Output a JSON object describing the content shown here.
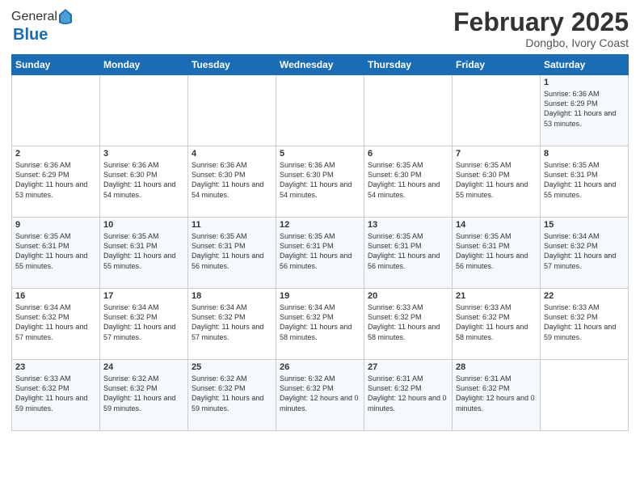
{
  "logo": {
    "general": "General",
    "blue": "Blue"
  },
  "title": "February 2025",
  "location": "Dongbo, Ivory Coast",
  "days_of_week": [
    "Sunday",
    "Monday",
    "Tuesday",
    "Wednesday",
    "Thursday",
    "Friday",
    "Saturday"
  ],
  "weeks": [
    [
      {
        "day": "",
        "info": ""
      },
      {
        "day": "",
        "info": ""
      },
      {
        "day": "",
        "info": ""
      },
      {
        "day": "",
        "info": ""
      },
      {
        "day": "",
        "info": ""
      },
      {
        "day": "",
        "info": ""
      },
      {
        "day": "1",
        "info": "Sunrise: 6:36 AM\nSunset: 6:29 PM\nDaylight: 11 hours and 53 minutes."
      }
    ],
    [
      {
        "day": "2",
        "info": "Sunrise: 6:36 AM\nSunset: 6:29 PM\nDaylight: 11 hours and 53 minutes."
      },
      {
        "day": "3",
        "info": "Sunrise: 6:36 AM\nSunset: 6:30 PM\nDaylight: 11 hours and 54 minutes."
      },
      {
        "day": "4",
        "info": "Sunrise: 6:36 AM\nSunset: 6:30 PM\nDaylight: 11 hours and 54 minutes."
      },
      {
        "day": "5",
        "info": "Sunrise: 6:36 AM\nSunset: 6:30 PM\nDaylight: 11 hours and 54 minutes."
      },
      {
        "day": "6",
        "info": "Sunrise: 6:35 AM\nSunset: 6:30 PM\nDaylight: 11 hours and 54 minutes."
      },
      {
        "day": "7",
        "info": "Sunrise: 6:35 AM\nSunset: 6:30 PM\nDaylight: 11 hours and 55 minutes."
      },
      {
        "day": "8",
        "info": "Sunrise: 6:35 AM\nSunset: 6:31 PM\nDaylight: 11 hours and 55 minutes."
      }
    ],
    [
      {
        "day": "9",
        "info": "Sunrise: 6:35 AM\nSunset: 6:31 PM\nDaylight: 11 hours and 55 minutes."
      },
      {
        "day": "10",
        "info": "Sunrise: 6:35 AM\nSunset: 6:31 PM\nDaylight: 11 hours and 55 minutes."
      },
      {
        "day": "11",
        "info": "Sunrise: 6:35 AM\nSunset: 6:31 PM\nDaylight: 11 hours and 56 minutes."
      },
      {
        "day": "12",
        "info": "Sunrise: 6:35 AM\nSunset: 6:31 PM\nDaylight: 11 hours and 56 minutes."
      },
      {
        "day": "13",
        "info": "Sunrise: 6:35 AM\nSunset: 6:31 PM\nDaylight: 11 hours and 56 minutes."
      },
      {
        "day": "14",
        "info": "Sunrise: 6:35 AM\nSunset: 6:31 PM\nDaylight: 11 hours and 56 minutes."
      },
      {
        "day": "15",
        "info": "Sunrise: 6:34 AM\nSunset: 6:32 PM\nDaylight: 11 hours and 57 minutes."
      }
    ],
    [
      {
        "day": "16",
        "info": "Sunrise: 6:34 AM\nSunset: 6:32 PM\nDaylight: 11 hours and 57 minutes."
      },
      {
        "day": "17",
        "info": "Sunrise: 6:34 AM\nSunset: 6:32 PM\nDaylight: 11 hours and 57 minutes."
      },
      {
        "day": "18",
        "info": "Sunrise: 6:34 AM\nSunset: 6:32 PM\nDaylight: 11 hours and 57 minutes."
      },
      {
        "day": "19",
        "info": "Sunrise: 6:34 AM\nSunset: 6:32 PM\nDaylight: 11 hours and 58 minutes."
      },
      {
        "day": "20",
        "info": "Sunrise: 6:33 AM\nSunset: 6:32 PM\nDaylight: 11 hours and 58 minutes."
      },
      {
        "day": "21",
        "info": "Sunrise: 6:33 AM\nSunset: 6:32 PM\nDaylight: 11 hours and 58 minutes."
      },
      {
        "day": "22",
        "info": "Sunrise: 6:33 AM\nSunset: 6:32 PM\nDaylight: 11 hours and 59 minutes."
      }
    ],
    [
      {
        "day": "23",
        "info": "Sunrise: 6:33 AM\nSunset: 6:32 PM\nDaylight: 11 hours and 59 minutes."
      },
      {
        "day": "24",
        "info": "Sunrise: 6:32 AM\nSunset: 6:32 PM\nDaylight: 11 hours and 59 minutes."
      },
      {
        "day": "25",
        "info": "Sunrise: 6:32 AM\nSunset: 6:32 PM\nDaylight: 11 hours and 59 minutes."
      },
      {
        "day": "26",
        "info": "Sunrise: 6:32 AM\nSunset: 6:32 PM\nDaylight: 12 hours and 0 minutes."
      },
      {
        "day": "27",
        "info": "Sunrise: 6:31 AM\nSunset: 6:32 PM\nDaylight: 12 hours and 0 minutes."
      },
      {
        "day": "28",
        "info": "Sunrise: 6:31 AM\nSunset: 6:32 PM\nDaylight: 12 hours and 0 minutes."
      },
      {
        "day": "",
        "info": ""
      }
    ]
  ]
}
